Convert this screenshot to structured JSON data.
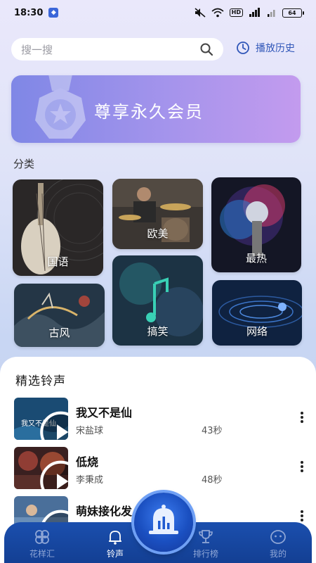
{
  "status_bar": {
    "time": "18:30",
    "battery": "64",
    "hd": "HD"
  },
  "search": {
    "placeholder": "搜一搜"
  },
  "history": {
    "label": "播放历史"
  },
  "vip": {
    "label": "尊享永久会员"
  },
  "categories": {
    "title": "分类",
    "items": [
      {
        "label": "国语"
      },
      {
        "label": "欧美"
      },
      {
        "label": "最热"
      },
      {
        "label": "古风"
      },
      {
        "label": "搞笑"
      },
      {
        "label": "网络"
      }
    ]
  },
  "selected": {
    "title": "精选铃声",
    "songs": [
      {
        "title": "我又不是仙",
        "artist": "宋盐球",
        "duration": "43秒",
        "thumb_text": "我又不是仙"
      },
      {
        "title": "低烧",
        "artist": "李秉成",
        "duration": "48秒"
      },
      {
        "title": "萌妹接化发",
        "artist": "",
        "duration": ""
      }
    ]
  },
  "nav": {
    "items": [
      {
        "label": "花样汇"
      },
      {
        "label": "铃声"
      },
      {
        "label": "排行榜"
      },
      {
        "label": "我的"
      }
    ]
  },
  "colors": {
    "accent": "#2f56b8",
    "nav_bg": "#1b4fae",
    "vip_start": "#7f87e6",
    "vip_end": "#c39bee"
  }
}
